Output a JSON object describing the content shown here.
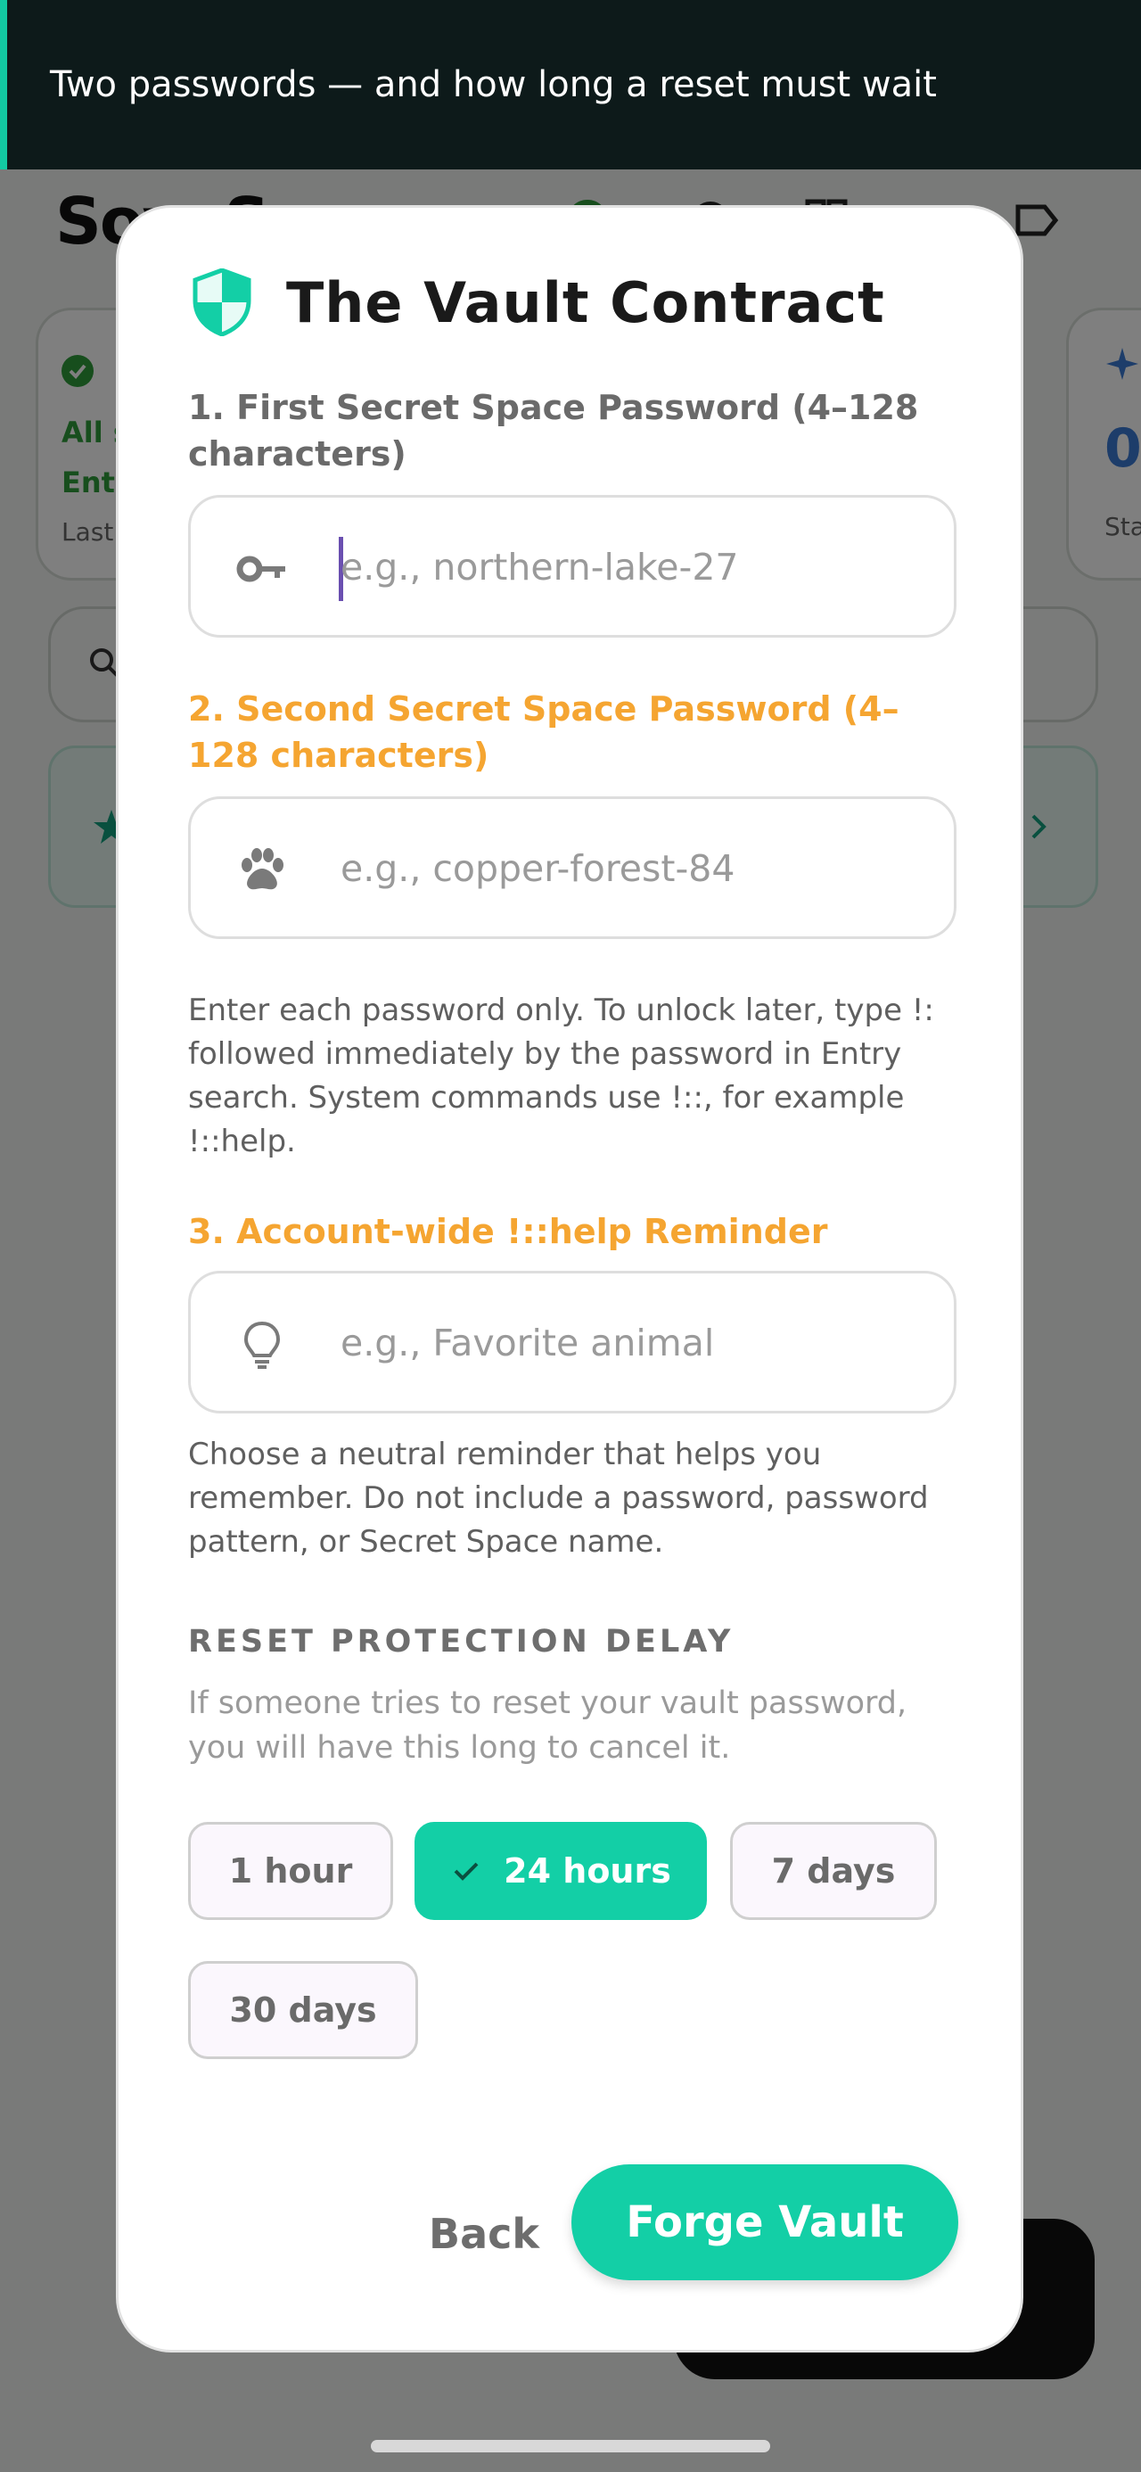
{
  "toast": {
    "text": "Two passwords — and how long a reset must wait"
  },
  "background_app": {
    "logo": "SoveSpace",
    "card_left": {
      "line1": "All s",
      "line2": "Ent",
      "line3": "Last"
    },
    "card_right": {
      "value": "0",
      "label": "Sta"
    }
  },
  "dialog": {
    "title": "The Vault Contract",
    "icon": "shield-icon",
    "fields": [
      {
        "label": "1. First Secret Space Password (4–128 characters)",
        "placeholder": "e.g., northern-lake-27",
        "value": "",
        "icon": "key-icon"
      },
      {
        "label": "2. Second Secret Space Password (4–128 characters)",
        "placeholder": "e.g., copper-forest-84",
        "value": "",
        "icon": "paw-icon"
      },
      {
        "label": "3. Account-wide !::help Reminder",
        "placeholder": "e.g., Favorite animal",
        "value": "",
        "icon": "lightbulb-icon"
      }
    ],
    "passwords_help": "Enter each password only. To unlock later, type !: followed immediately by the password in Entry search. System commands use !::, for example !::help.",
    "reminder_help": "Choose a neutral reminder that helps you remember. Do not include a password, password pattern, or Secret Space name.",
    "reset": {
      "heading": "RESET PROTECTION DELAY",
      "description": "If someone tries to reset your vault password, you will have this long to cancel it.",
      "options": [
        "1 hour",
        "24 hours",
        "7 days",
        "30 days"
      ],
      "selected": "24 hours"
    },
    "buttons": {
      "back": "Back",
      "forge": "Forge Vault"
    }
  },
  "colors": {
    "accent": "#13cfa6",
    "orange": "#f5a531",
    "toast_bg": "#0d1a1a"
  }
}
